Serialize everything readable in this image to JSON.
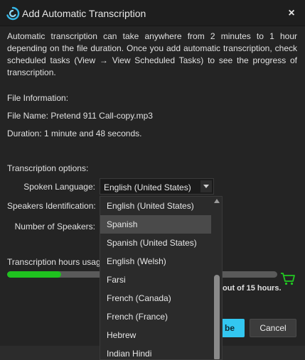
{
  "window": {
    "title": "Add Automatic Transcription",
    "close_label": "×"
  },
  "intro": "Automatic transcription can take anywhere from 2 minutes to 1 hour depending on the file duration. Once you add automatic transcription, check scheduled tasks (View → View Scheduled Tasks) to see the progress of transcription.",
  "file_info": {
    "heading": "File Information:",
    "file_name": "File Name: Pretend 911 Call-copy.mp3",
    "duration": "Duration: 1 minute and 48 seconds."
  },
  "options": {
    "heading": "Transcription options:",
    "spoken_language_label": "Spoken Language:",
    "spoken_language_value": "English (United States)",
    "speakers_identification_label": "Speakers Identification:",
    "number_of_speakers_label": "Number of Speakers:"
  },
  "usage": {
    "label": "Transcription hours usag",
    "text": "out of 15 hours.",
    "fraction_used": 0.2
  },
  "buttons": {
    "primary_label": "be",
    "cancel_label": "Cancel"
  },
  "language_dropdown": {
    "highlighted_index": 1,
    "options": [
      "English (United States)",
      "Spanish",
      "Spanish (United States)",
      "English (Welsh)",
      "Farsi",
      "French (Canada)",
      "French (France)",
      "Hebrew",
      "Indian Hindi"
    ]
  },
  "colors": {
    "accent": "#33c7f0",
    "progress": "#1fc21f",
    "background": "#242424"
  },
  "icons": {
    "app": "transcription-logo-icon",
    "close": "close-icon",
    "dropdown": "chevron-down-icon",
    "cart": "shopping-cart-icon",
    "scroll_up": "scroll-up-arrow-icon"
  }
}
